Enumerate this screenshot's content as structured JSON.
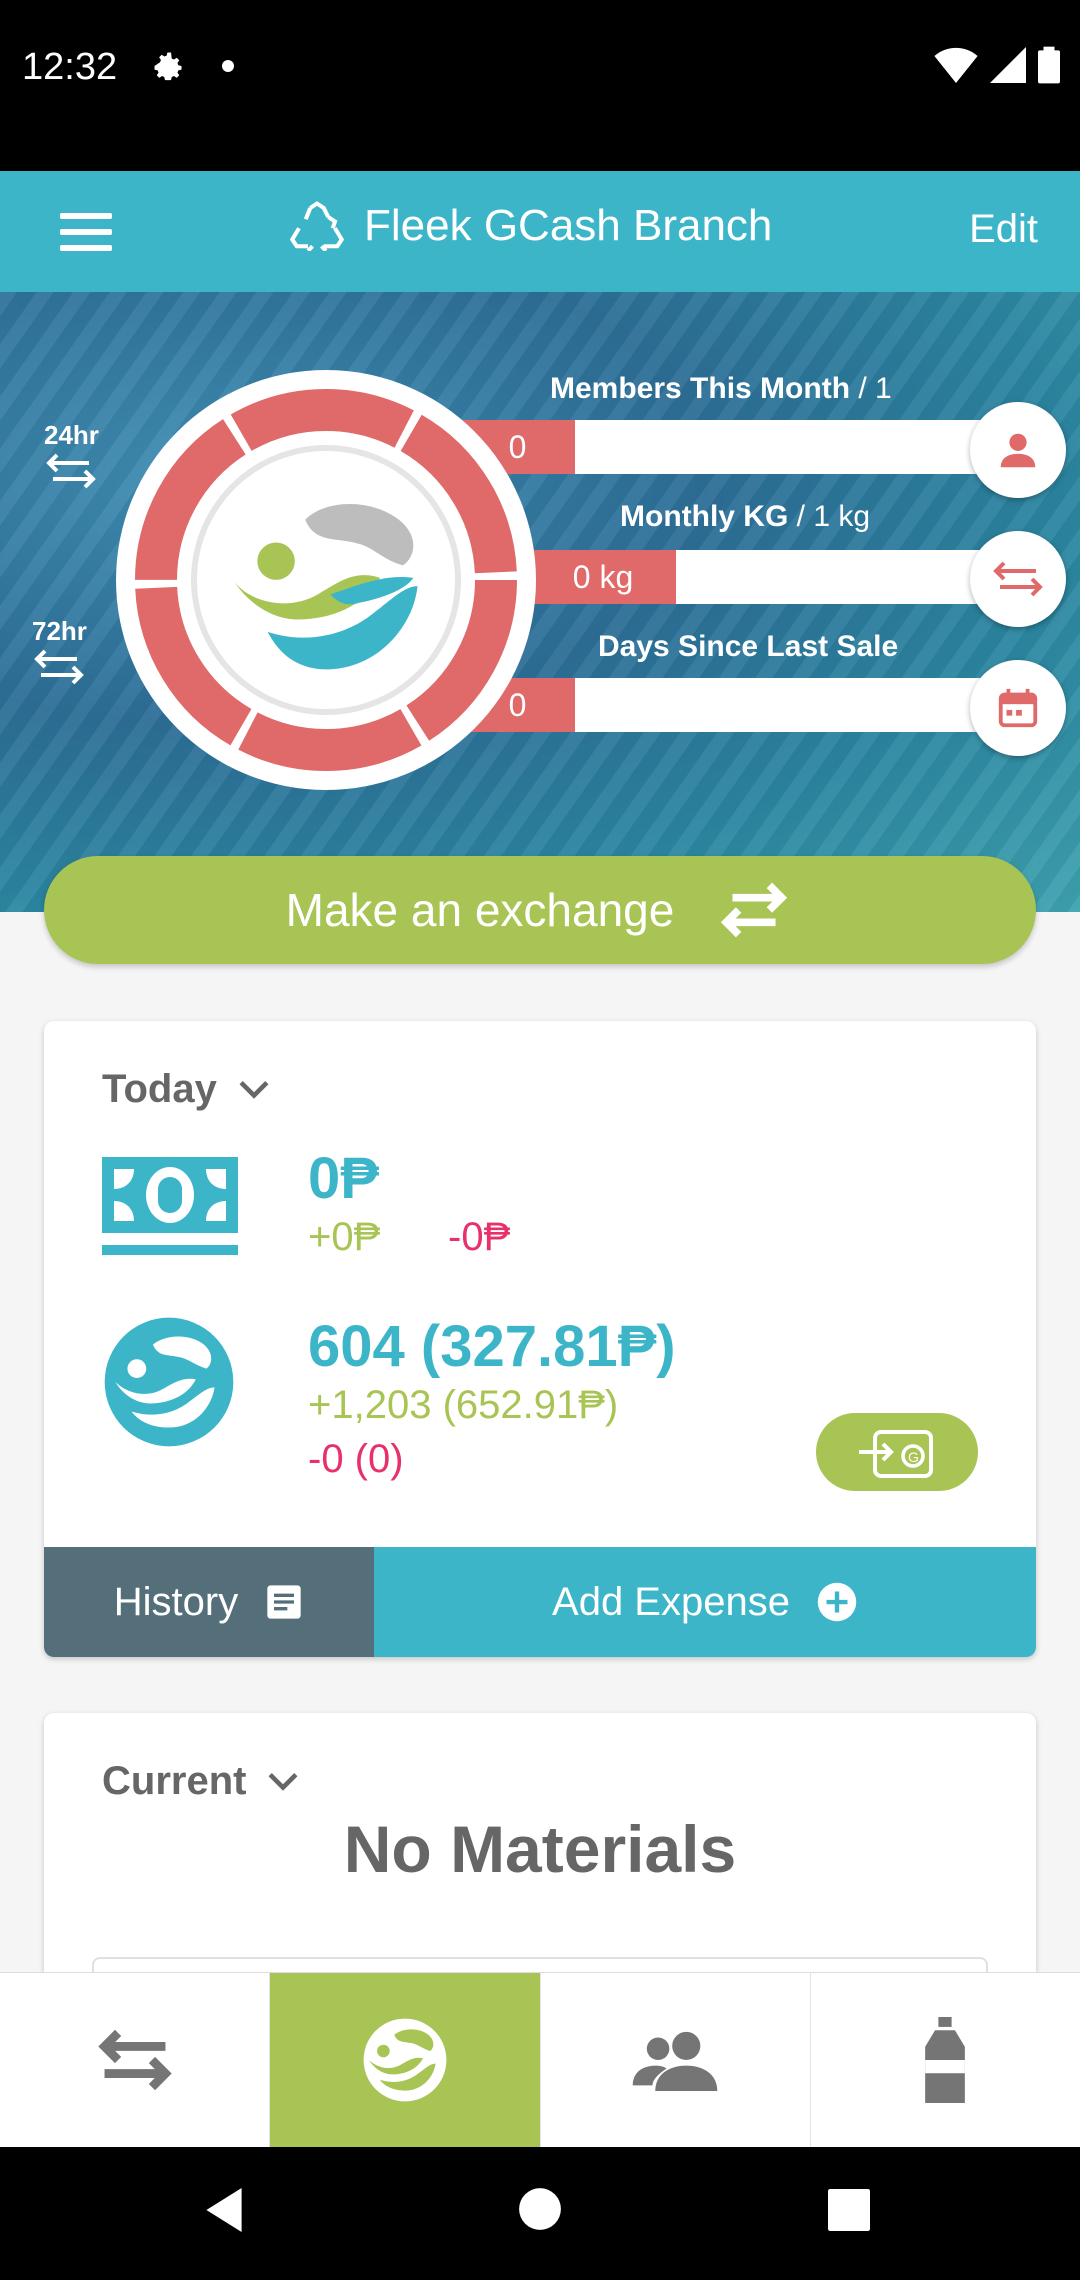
{
  "status_bar": {
    "time": "12:32"
  },
  "app_bar": {
    "title": "Fleek GCash Branch",
    "edit_label": "Edit"
  },
  "hero": {
    "timing_24": "24hr",
    "timing_72": "72hr",
    "members": {
      "label": "Members This Month",
      "target": "/ 1",
      "value": "0"
    },
    "monthly_kg": {
      "label": "Monthly KG",
      "target": "/ 1 kg",
      "value": "0 kg"
    },
    "days_since": {
      "label": "Days Since Last Sale",
      "value": "0"
    }
  },
  "exchange_button": {
    "label": "Make an exchange"
  },
  "today_card": {
    "period": "Today",
    "cash": {
      "total": "0₱",
      "plus": "+0₱",
      "minus": "-0₱"
    },
    "points": {
      "total": "604 (327.81₱)",
      "plus": "+1,203 (652.91₱)",
      "minus": "-0 (0)"
    },
    "history_label": "History",
    "add_expense_label": "Add Expense"
  },
  "current_card": {
    "period": "Current",
    "empty_text": "No Materials"
  },
  "colors": {
    "primary": "#3db5c9",
    "accent_green": "#a8c455",
    "alert_red": "#e06a6a",
    "negative": "#e8306a",
    "history_gray": "#546e7a"
  },
  "bottom_nav": {
    "active_index": 1,
    "icons": [
      "exchange-icon",
      "logo-icon",
      "members-icon",
      "bottle-icon"
    ]
  }
}
